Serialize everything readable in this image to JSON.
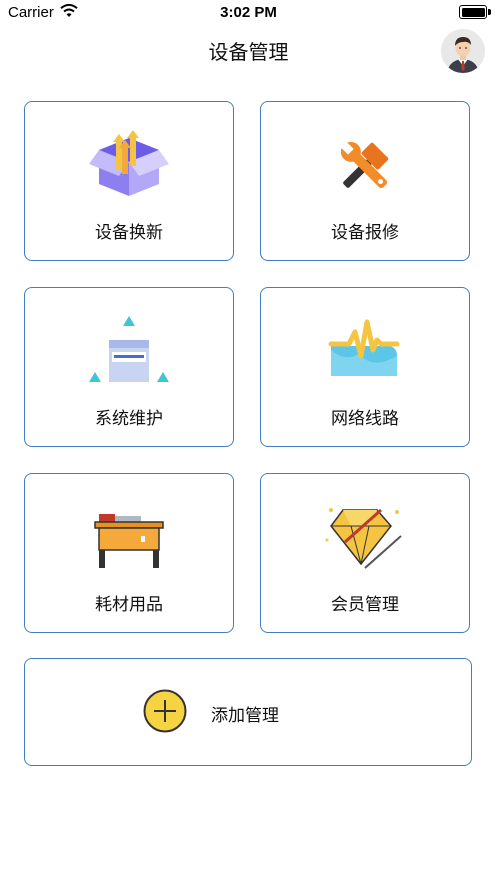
{
  "status_bar": {
    "carrier": "Carrier",
    "time": "3:02 PM"
  },
  "navbar": {
    "title": "设备管理"
  },
  "menu": [
    {
      "label": "设备换新",
      "icon": "box-upgrade-icon"
    },
    {
      "label": "设备报修",
      "icon": "tools-repair-icon"
    },
    {
      "label": "系统维护",
      "icon": "server-maintenance-icon"
    },
    {
      "label": "网络线路",
      "icon": "network-signal-icon"
    },
    {
      "label": "耗材用品",
      "icon": "desk-supplies-icon"
    },
    {
      "label": "会员管理",
      "icon": "diamond-member-icon"
    }
  ],
  "add_card": {
    "label": "添加管理",
    "icon": "plus-circle-icon"
  },
  "colors": {
    "card_border": "#3f7fc2",
    "accent_yellow": "#f5d342"
  }
}
